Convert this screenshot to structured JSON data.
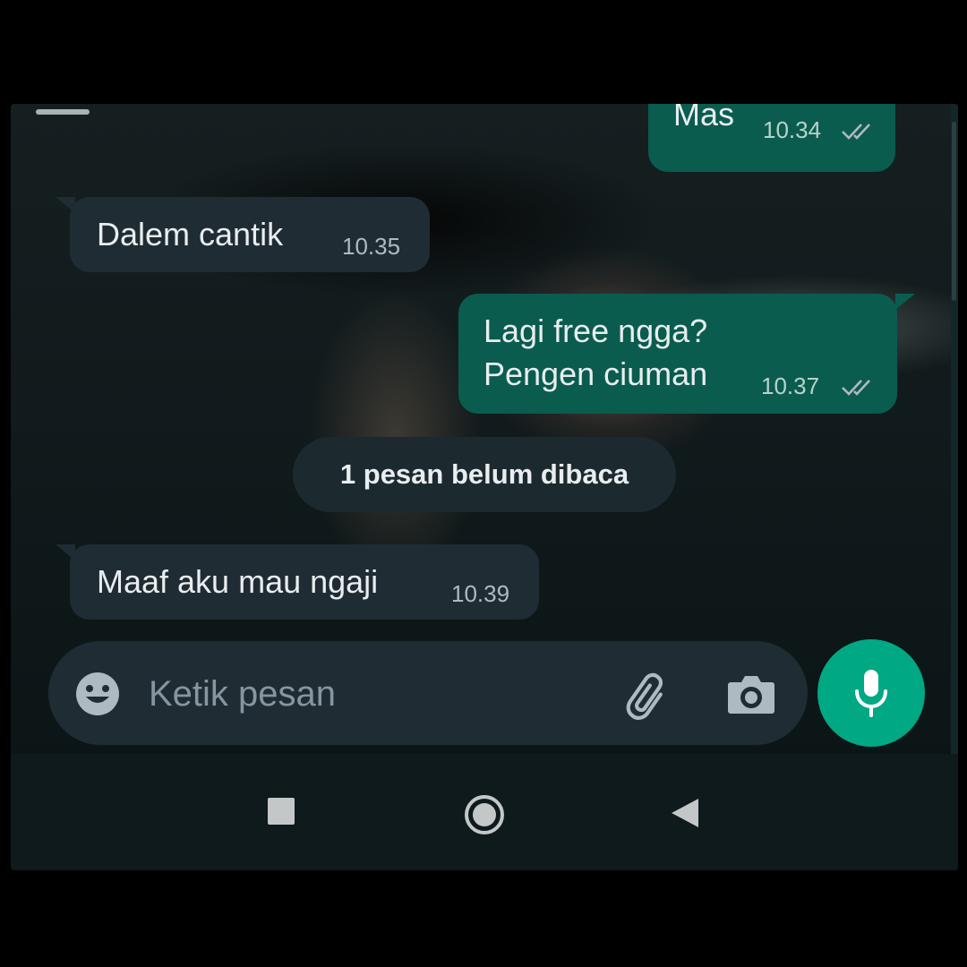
{
  "messages": [
    {
      "direction": "outgoing",
      "text": "Mas",
      "time": "10.34",
      "status_icon": "double-check-icon"
    },
    {
      "direction": "incoming",
      "text": "Dalem cantik",
      "time": "10.35"
    },
    {
      "direction": "outgoing",
      "text": "Lagi free ngga?\nPengen ciuman",
      "time": "10.37",
      "status_icon": "double-check-icon"
    },
    {
      "direction": "incoming",
      "text": "Maaf aku mau ngaji",
      "time": "10.39"
    }
  ],
  "unread_banner": "1 pesan belum dibaca",
  "composer": {
    "placeholder": "Ketik pesan",
    "icons": [
      "emoji-icon",
      "paperclip-icon",
      "camera-icon",
      "microphone-icon"
    ]
  },
  "nav_bar": {
    "icons": [
      "recents-square-icon",
      "home-circle-icon",
      "back-triangle-icon"
    ]
  },
  "colors": {
    "incoming_bubble": "#1f2c33",
    "outgoing_bubble": "#0a5c4e",
    "accent": "#00a884"
  }
}
